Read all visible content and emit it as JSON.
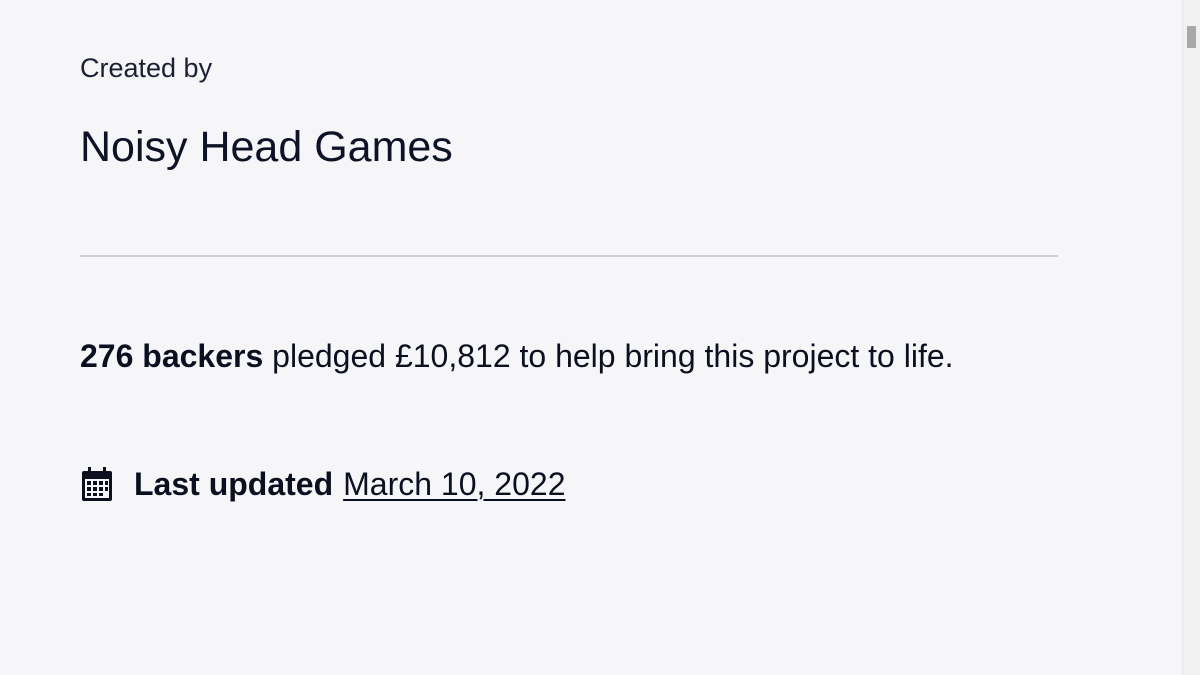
{
  "creator": {
    "label": "Created by",
    "name": "Noisy Head Games"
  },
  "pledge": {
    "backers": "276 backers",
    "text": " pledged £10,812 to help bring this project to life."
  },
  "update": {
    "icon": "calendar-icon",
    "label": "Last updated",
    "date": "March 10, 2022"
  },
  "colors": {
    "background": "#f6f6f9",
    "text": "#0b1020",
    "divider": "#cfd0d6"
  }
}
